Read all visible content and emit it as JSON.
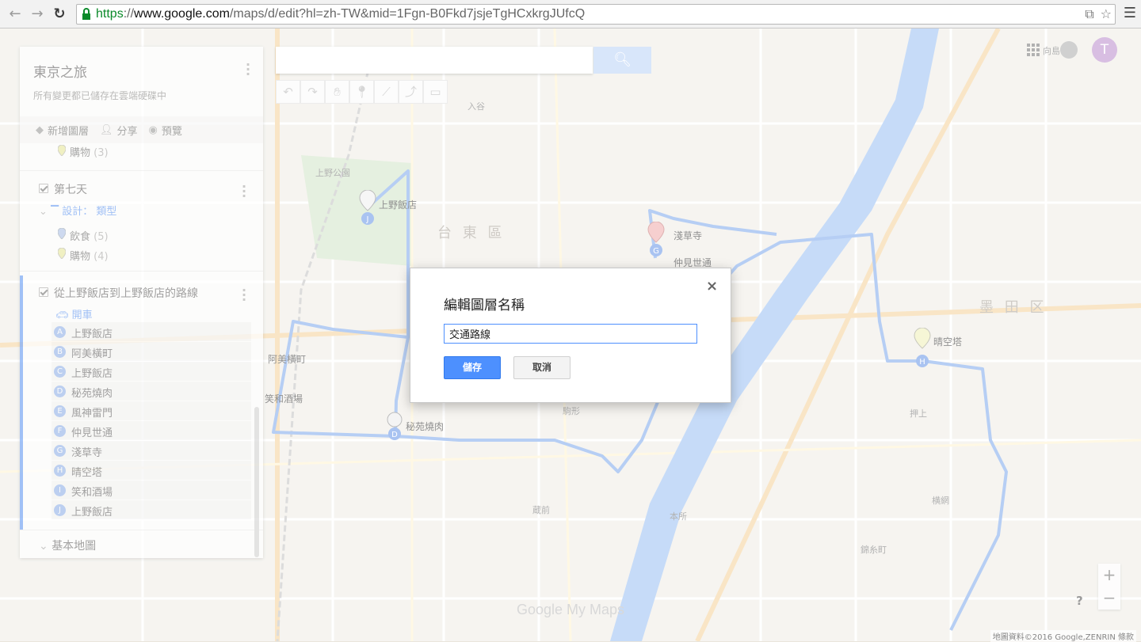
{
  "browser": {
    "url_scheme": "https",
    "url_host": "www.google.com",
    "url_path": "/maps/d/edit?hl=zh-TW&mid=1Fgn-B0Fkd7jsjeTgHCxkrgJUfcQ"
  },
  "map_title": "東京之旅",
  "save_status": "所有變更都已儲存在雲端硬碟中",
  "actions": {
    "add_layer": "新增圖層",
    "share": "分享",
    "preview": "預覽"
  },
  "layers": {
    "prev_item": {
      "label": "購物",
      "count": "(3)"
    },
    "day7": {
      "name": "第七天",
      "design_label": "設計：",
      "design_value": "類型",
      "items": [
        {
          "label": "飲食",
          "count": "(5)",
          "color": "#9fb7e6"
        },
        {
          "label": "購物",
          "count": "(4)",
          "color": "#e7e88a"
        }
      ]
    },
    "route": {
      "name": "從上野飯店到上野飯店的路線",
      "mode": "開車",
      "stops": [
        {
          "letter": "A",
          "label": "上野飯店"
        },
        {
          "letter": "B",
          "label": "阿美橫町"
        },
        {
          "letter": "C",
          "label": "上野飯店"
        },
        {
          "letter": "D",
          "label": "秘苑燒肉"
        },
        {
          "letter": "E",
          "label": "風神雷門"
        },
        {
          "letter": "F",
          "label": "仲見世通"
        },
        {
          "letter": "G",
          "label": "淺草寺"
        },
        {
          "letter": "H",
          "label": "晴空塔"
        },
        {
          "letter": "I",
          "label": "笑和酒場"
        },
        {
          "letter": "J",
          "label": "上野飯店"
        }
      ]
    },
    "base_map": "基本地圖"
  },
  "user_initial": "T",
  "dialog": {
    "title": "編輯圖層名稱",
    "input_value": "交通路線",
    "save": "儲存",
    "cancel": "取消",
    "close": "×"
  },
  "watermark": "Google My Maps",
  "attribution": "地圖資料©2016 Google,ZENRIN  條款",
  "map_labels": {
    "taito": "台 東 區",
    "sumida": "墨 田 区",
    "ueno_hotel": "上野飯店",
    "asakusa": "淺草寺",
    "nakamise": "仲見世通",
    "skytree": "晴空塔",
    "ameyoko": "阿美橫町",
    "hien": "秘苑燒肉",
    "showa": "笑和酒場",
    "ueno_park": "上野公園",
    "iriya": "入谷",
    "kuramae": "蔵前",
    "oshiage": "押上",
    "honjo": "本所",
    "komagata": "駒形",
    "yokoami": "横網",
    "kinshicho": "錦糸町",
    "mukojima": "向島"
  },
  "colors": {
    "route": "#8fb4ee",
    "river": "#a8c8f5",
    "accent": "#4d90fe"
  }
}
